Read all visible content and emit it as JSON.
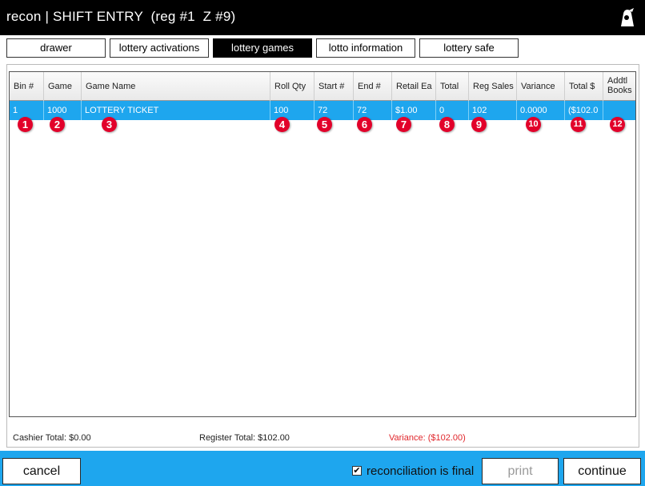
{
  "header": {
    "title": "recon | SHIFT ENTRY  (reg #1  Z #9)",
    "logo_icon": "store-logo-icon"
  },
  "tabs": [
    {
      "label": "drawer",
      "active": false
    },
    {
      "label": "lottery activations",
      "active": false
    },
    {
      "label": "lottery games",
      "active": true
    },
    {
      "label": "lotto information",
      "active": false
    },
    {
      "label": "lottery safe",
      "active": false
    }
  ],
  "table": {
    "columns": [
      "Bin #",
      "Game",
      "Game Name",
      "Roll Qty",
      "Start #",
      "End #",
      "Retail Ea",
      "Total",
      "Reg Sales",
      "Variance",
      "Total $",
      "Addtl Books"
    ],
    "rows": [
      [
        "1",
        "1000",
        "LOTTERY TICKET",
        "100",
        "72",
        "72",
        "$1.00",
        "0",
        "102",
        "0.0000",
        "($102.0",
        ""
      ]
    ],
    "annotation_badges": [
      "1",
      "2",
      "3",
      "4",
      "5",
      "6",
      "7",
      "8",
      "9",
      "10",
      "11",
      "12"
    ],
    "selected_row_color": "#1ea6ee",
    "badge_color": "#e2002a"
  },
  "summary": {
    "cashier_total": "Cashier Total: $0.00",
    "register_total": "Register Total: $102.00",
    "variance": "Variance: ($102.00)",
    "variance_color": "#e0262b"
  },
  "footer": {
    "cancel_label": "cancel",
    "reconciliation_label": "reconciliation is final",
    "reconciliation_checked": true,
    "print_label": "print",
    "print_enabled": false,
    "continue_label": "continue",
    "bar_color": "#1ea6ee"
  }
}
